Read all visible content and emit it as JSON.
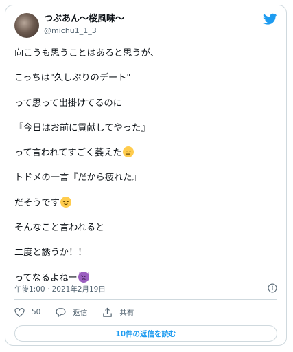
{
  "tweet": {
    "author": {
      "display_name": "つぶあん〜桜風味〜",
      "handle": "@michu1_1_3"
    },
    "lines": [
      {
        "text": "向こうも思うことはあると思うが、",
        "emoji": null
      },
      {
        "text": "こっちは\"久しぶりのデート\"",
        "emoji": null
      },
      {
        "text": "って思って出掛けてるのに",
        "emoji": null
      },
      {
        "text": "『今日はお前に貢献してやった』",
        "emoji": null
      },
      {
        "text": "って言われてすごく萎えた",
        "emoji": "expressionless-face"
      },
      {
        "text": "トドメの一言『だから疲れた』",
        "emoji": null
      },
      {
        "text": "だそうです",
        "emoji": "relieved-face"
      },
      {
        "text": "そんなこと言われると",
        "emoji": null
      },
      {
        "text": "二度と誘うか！！",
        "emoji": null
      },
      {
        "text": "ってなるよねー",
        "emoji": "angry-devil-face"
      }
    ],
    "timestamp": "午後1:00 · 2021年2月19日",
    "actions": {
      "like_count": "50",
      "reply_label": "返信",
      "share_label": "共有"
    },
    "read_replies_label": "10件の返信を読む"
  },
  "colors": {
    "accent": "#1d9bf0",
    "secondary_text": "#536471",
    "border": "#cfd9de",
    "like_icon": "#536471"
  }
}
